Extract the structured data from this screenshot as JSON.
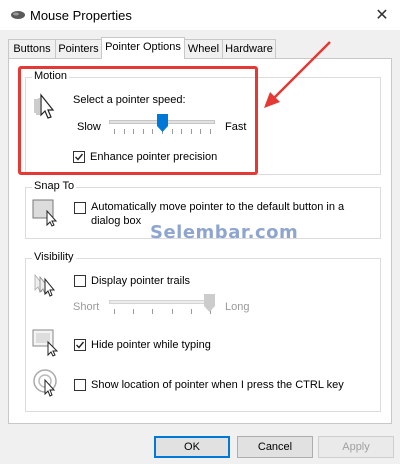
{
  "window": {
    "title": "Mouse Properties",
    "close_label": "✕"
  },
  "tabs": [
    {
      "label": "Buttons",
      "active": false
    },
    {
      "label": "Pointers",
      "active": false
    },
    {
      "label": "Pointer Options",
      "active": true
    },
    {
      "label": "Wheel",
      "active": false
    },
    {
      "label": "Hardware",
      "active": false
    }
  ],
  "motion": {
    "label": "Motion",
    "speed_prompt": "Select a pointer speed:",
    "slow_label": "Slow",
    "fast_label": "Fast",
    "speed_value": 0.5,
    "enhance_label": "Enhance pointer precision",
    "enhance_checked": true
  },
  "snap": {
    "label": "Snap To",
    "auto_move_label_1": "Automatically move pointer to the default button in a",
    "auto_move_label_2": "dialog box",
    "auto_move_checked": false
  },
  "visibility": {
    "label": "Visibility",
    "trails_label": "Display pointer trails",
    "trails_checked": false,
    "short_label": "Short",
    "long_label": "Long",
    "trail_length": 1.0,
    "hide_label": "Hide pointer while typing",
    "hide_checked": true,
    "ctrl_label": "Show location of pointer when I press the CTRL key",
    "ctrl_checked": false
  },
  "buttons": {
    "ok": "OK",
    "cancel": "Cancel",
    "apply": "Apply"
  },
  "watermark": "Selembar.com",
  "colors": {
    "highlight": "#e53935",
    "accent": "#0078d7",
    "slider_thumb": "#0078d7"
  }
}
